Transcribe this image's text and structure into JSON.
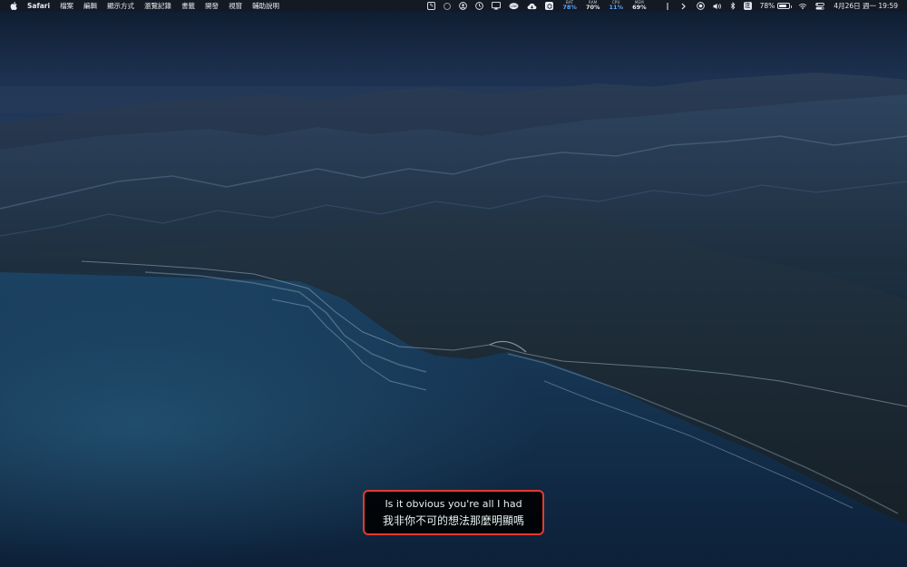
{
  "menubar": {
    "app_name": "Safari",
    "menus": [
      "檔案",
      "編輯",
      "顯示方式",
      "瀏覽記錄",
      "書籤",
      "開發",
      "視窗",
      "輔助說明"
    ],
    "status": {
      "bat_label": "BAT",
      "bat_value": "78%",
      "ram_label": "RAM",
      "ram_value": "70%",
      "cpu_label": "CPU",
      "cpu_value": "11%",
      "mem_label": "MEM",
      "mem_value": "69%",
      "battery_percent_text": "78%",
      "battery_level": 0.78,
      "datetime": "4月26日 週一  19:59"
    },
    "icons": [
      "notes-icon",
      "app-icon",
      "user-icon",
      "clock-icon",
      "cast-icon",
      "line-icon",
      "cloud-download-icon",
      "dropbox-icon",
      "separator-icon",
      "chevron-right-icon",
      "record-icon",
      "volume-icon",
      "bluetooth-icon",
      "input-method-icon",
      "battery-icon",
      "wifi-icon",
      "control-center-icon"
    ],
    "colors": {
      "stat_highlight": "#5aa8ff"
    }
  },
  "subtitle": {
    "line1": "Is it obvious you're all I had",
    "line2": "我非你不可的想法那麼明顯嗎",
    "border_color": "#e43a30"
  }
}
